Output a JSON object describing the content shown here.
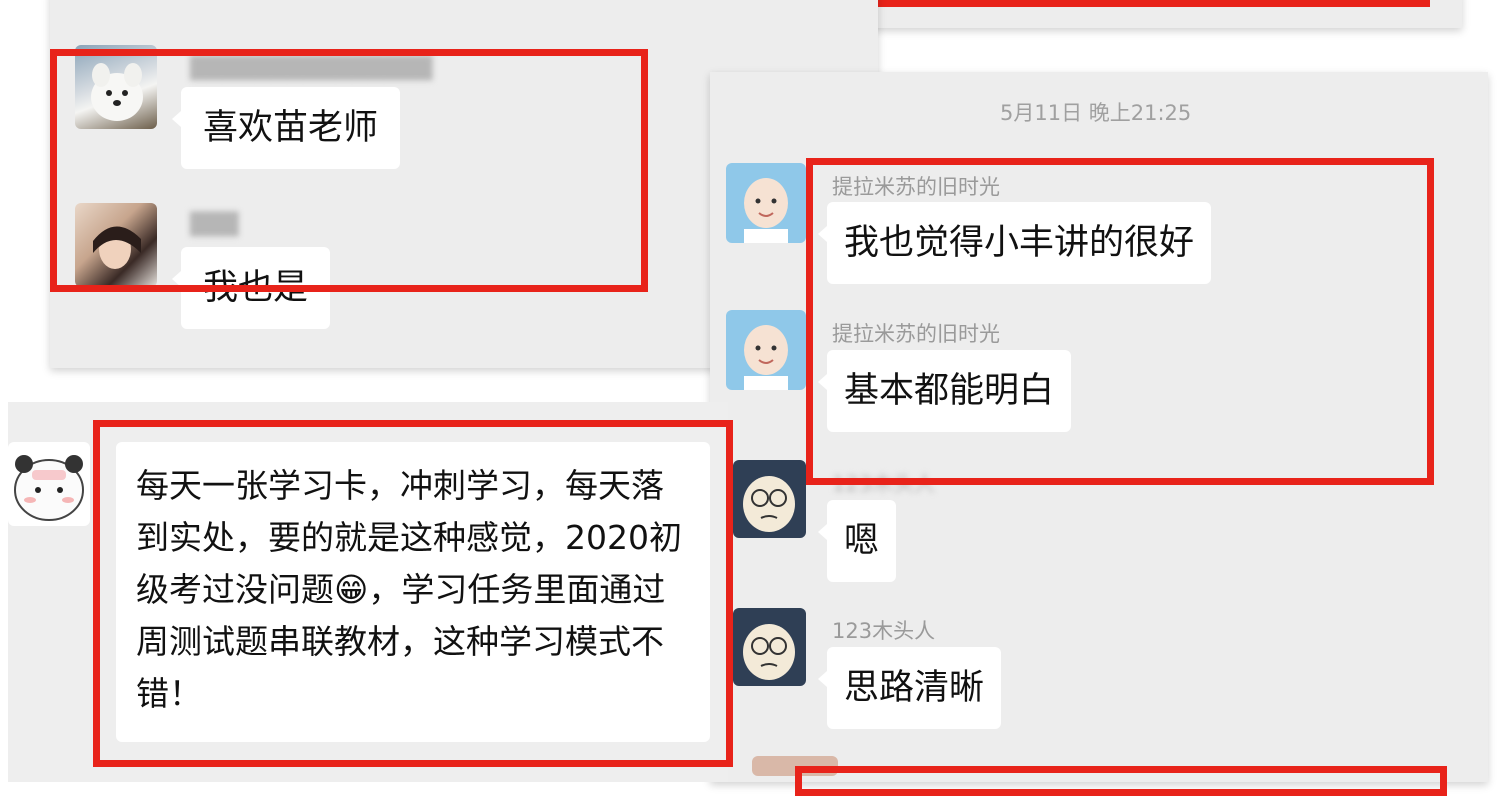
{
  "colors": {
    "highlight": "#e8231a",
    "panel_bg": "#ededed",
    "bubble_bg": "#ffffff",
    "name_text": "#9a9a9a"
  },
  "panel_left": {
    "messages": [
      {
        "avatar": "dog-avatar",
        "sender": "",
        "text": "喜欢苗老师"
      },
      {
        "avatar": "person-avatar",
        "sender": "",
        "text": "我也是"
      }
    ]
  },
  "panel_right": {
    "timestamp": "5月11日 晚上21:25",
    "messages": [
      {
        "avatar": "baby-avatar",
        "sender": "提拉米苏的旧时光",
        "text": "我也觉得小丰讲的很好"
      },
      {
        "avatar": "baby-avatar",
        "sender": "提拉米苏的旧时光",
        "text": "基本都能明白"
      },
      {
        "avatar": "cartoon-avatar",
        "sender": "",
        "text": "嗯"
      },
      {
        "avatar": "cartoon-avatar",
        "sender": "123木头人",
        "text": "思路清晰"
      }
    ]
  },
  "panel_bottom": {
    "avatar": "panda-sticker-avatar",
    "text_before_emoji": "每天一张学习卡，冲刺学习，每天落到实处，要的就是这种感觉，2020初级考过没问题",
    "emoji": "😁",
    "text_after_emoji": "，学习任务里面通过周测试题串联教材，这种学习模式不错！"
  }
}
